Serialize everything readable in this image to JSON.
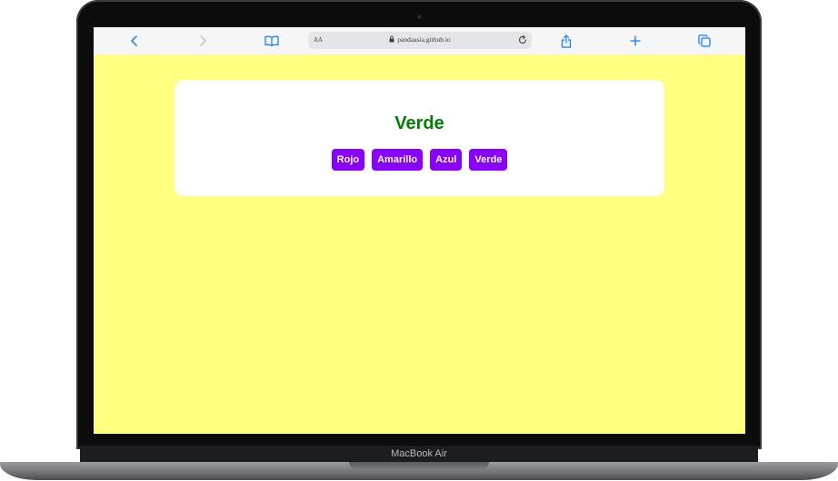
{
  "browser": {
    "address_text_size_label": "AA",
    "url": "pandaasia.github.io"
  },
  "page": {
    "color_name": "Verde",
    "color_name_color": "#008000",
    "background_color": "#ffff80",
    "button_color": "#8a00ff",
    "buttons": [
      {
        "label": "Rojo"
      },
      {
        "label": "Amarillo"
      },
      {
        "label": "Azul"
      },
      {
        "label": "Verde"
      }
    ]
  },
  "device": {
    "model_label": "MacBook Air"
  }
}
